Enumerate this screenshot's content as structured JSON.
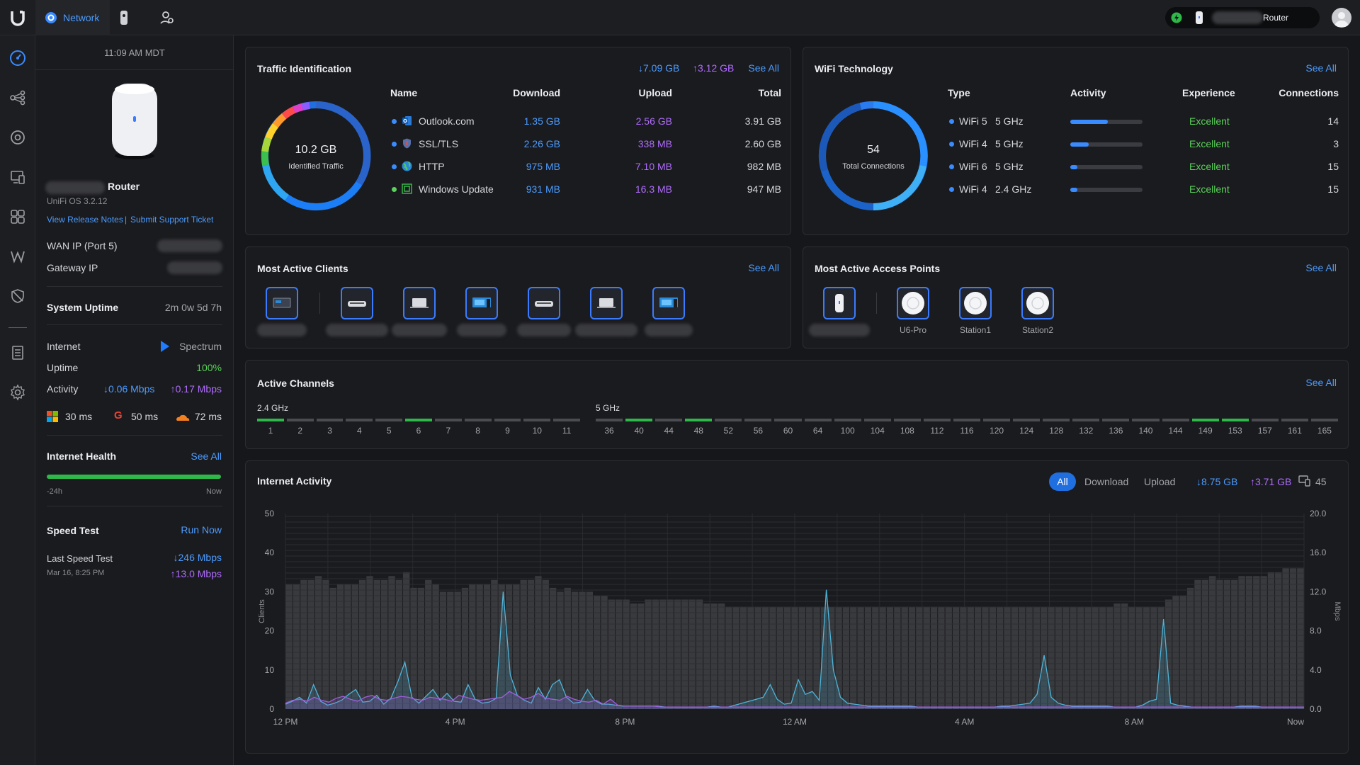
{
  "topbar": {
    "app_name": "Network",
    "device_name": "Router"
  },
  "side": {
    "time": "11:09 AM MDT",
    "device_name": "Router",
    "os_version": "UniFi OS 3.2.12",
    "release_notes": "View Release Notes",
    "separator": "|",
    "support_ticket": "Submit Support Ticket",
    "wan_ip_label": "WAN IP (Port 5)",
    "gateway_ip_label": "Gateway IP",
    "uptime_label": "System Uptime",
    "uptime_value": "2m 0w 5d 7h",
    "internet_label": "Internet",
    "isp": "Spectrum",
    "uptime2_label": "Uptime",
    "uptime2_value": "100%",
    "activity_label": "Activity",
    "activity_down": "↓0.06 Mbps",
    "activity_up": "↑0.17 Mbps",
    "latency_ms_windows": "30 ms",
    "latency_ms_google": "50 ms",
    "latency_ms_cloudflare": "72 ms",
    "health_label": "Internet Health",
    "health_seeall": "See All",
    "health_left": "-24h",
    "health_right": "Now",
    "speedtest_label": "Speed Test",
    "run_now": "Run Now",
    "last_speed_label": "Last Speed Test",
    "last_speed_date": "Mar 16, 8:25 PM",
    "last_speed_down": "↓246 Mbps",
    "last_speed_up": "↑13.0 Mbps"
  },
  "traffic": {
    "title": "Traffic Identification",
    "down_total": "↓7.09 GB",
    "up_total": "↑3.12 GB",
    "see_all": "See All",
    "center_value": "10.2 GB",
    "center_label": "Identified Traffic",
    "headers": [
      "Name",
      "Download",
      "Upload",
      "Total"
    ],
    "rows": [
      {
        "name": "Outlook.com",
        "download": "1.35 GB",
        "upload": "2.56 GB",
        "total": "3.91 GB",
        "dot": "#3a8bff",
        "icon": "outlook-icon"
      },
      {
        "name": "SSL/TLS",
        "download": "2.26 GB",
        "upload": "338 MB",
        "total": "2.60 GB",
        "dot": "#3a8bff",
        "icon": "shield-icon"
      },
      {
        "name": "HTTP",
        "download": "975 MB",
        "upload": "7.10 MB",
        "total": "982 MB",
        "dot": "#3a8bff",
        "icon": "globe-icon"
      },
      {
        "name": "Windows Update",
        "download": "931 MB",
        "upload": "16.3 MB",
        "total": "947 MB",
        "dot": "#5ad15a",
        "icon": "windows-update-icon"
      }
    ]
  },
  "wifi": {
    "title": "WiFi Technology",
    "see_all": "See All",
    "center_value": "54",
    "center_label": "Total Connections",
    "headers": [
      "Type",
      "Activity",
      "Experience",
      "Connections"
    ],
    "rows": [
      {
        "type": "WiFi 5",
        "band": "5 GHz",
        "activity": 0.52,
        "experience": "Excellent",
        "connections": "14"
      },
      {
        "type": "WiFi 4",
        "band": "5 GHz",
        "activity": 0.25,
        "experience": "Excellent",
        "connections": "3"
      },
      {
        "type": "WiFi 6",
        "band": "5 GHz",
        "activity": 0.1,
        "experience": "Excellent",
        "connections": "15"
      },
      {
        "type": "WiFi 4",
        "band": "2.4 GHz",
        "activity": 0.1,
        "experience": "Excellent",
        "connections": "15"
      }
    ]
  },
  "clients": {
    "title": "Most Active Clients",
    "see_all": "See All",
    "items": [
      {
        "icon": "desktop-icon"
      },
      {
        "icon": "console-icon"
      },
      {
        "icon": "laptop-icon"
      },
      {
        "icon": "tv-icon"
      },
      {
        "icon": "console-icon"
      },
      {
        "icon": "laptop-icon"
      },
      {
        "icon": "tv-icon"
      }
    ]
  },
  "aps": {
    "title": "Most Active Access Points",
    "see_all": "See All",
    "items": [
      {
        "label": "",
        "icon": "router-icon"
      },
      {
        "label": "U6-Pro",
        "icon": "access-point-icon"
      },
      {
        "label": "Station1",
        "icon": "access-point-icon"
      },
      {
        "label": "Station2",
        "icon": "access-point-icon"
      }
    ]
  },
  "channels": {
    "title": "Active Channels",
    "see_all": "See All",
    "band24_label": "2.4 GHz",
    "band5_label": "5 GHz",
    "band24": [
      "1",
      "2",
      "3",
      "4",
      "5",
      "6",
      "7",
      "8",
      "9",
      "10",
      "11"
    ],
    "band24_active": [
      "1",
      "6"
    ],
    "band5": [
      "36",
      "40",
      "44",
      "48",
      "52",
      "56",
      "60",
      "64",
      "100",
      "104",
      "108",
      "112",
      "116",
      "120",
      "124",
      "128",
      "132",
      "136",
      "140",
      "144",
      "149",
      "153",
      "157",
      "161",
      "165"
    ],
    "band5_active": [
      "40",
      "48",
      "149",
      "153"
    ]
  },
  "activity": {
    "title": "Internet Activity",
    "tab_all": "All",
    "tab_download": "Download",
    "tab_upload": "Upload",
    "down_total": "↓8.75 GB",
    "up_total": "↑3.71 GB",
    "client_count": "45"
  },
  "chart_data": {
    "type": "area",
    "title": "Internet Activity",
    "ylabel": "Clients",
    "y2label": "Mbps",
    "ylim": [
      0,
      50
    ],
    "y2lim": [
      0,
      20
    ],
    "yticks": [
      "50",
      "40",
      "30",
      "20",
      "10",
      "0"
    ],
    "y2ticks": [
      "20.0",
      "16.0",
      "12.0",
      "8.0",
      "4.0",
      "0.0"
    ],
    "xticks": [
      "12 PM",
      "4 PM",
      "8 PM",
      "12 AM",
      "4 AM",
      "8 AM",
      "Now"
    ],
    "clients": [
      32,
      32,
      33,
      33,
      34,
      33,
      31,
      32,
      32,
      32,
      33,
      34,
      33,
      33,
      34,
      33,
      35,
      31,
      31,
      33,
      32,
      30,
      30,
      30,
      31,
      32,
      32,
      32,
      33,
      32,
      32,
      32,
      33,
      33,
      34,
      33,
      31,
      30,
      31,
      30,
      30,
      30,
      29,
      29,
      28,
      28,
      28,
      27,
      27,
      28,
      28,
      28,
      28,
      28,
      28,
      28,
      28,
      27,
      27,
      27,
      26,
      26,
      26,
      26,
      26,
      26,
      26,
      26,
      26,
      26,
      26,
      26,
      26,
      26,
      26,
      26,
      26,
      26,
      26,
      26,
      26,
      26,
      26,
      26,
      26,
      26,
      26,
      26,
      26,
      26,
      26,
      26,
      26,
      26,
      26,
      26,
      26,
      26,
      26,
      26,
      26,
      26,
      26,
      26,
      26,
      26,
      26,
      26,
      26,
      26,
      26,
      26,
      26,
      27,
      27,
      26,
      26,
      26,
      26,
      26,
      28,
      29,
      29,
      31,
      33,
      33,
      34,
      33,
      33,
      33,
      34,
      34,
      34,
      34,
      35,
      35,
      36,
      36,
      36
    ],
    "series": [
      {
        "name": "Download",
        "color": "#4fb4d8",
        "values": [
          0.5,
          0.8,
          1.2,
          0.6,
          2.5,
          0.8,
          0.4,
          0.6,
          0.9,
          1.5,
          2.0,
          0.7,
          0.8,
          1.4,
          0.5,
          1.1,
          2.8,
          4.8,
          1.2,
          0.6,
          1.3,
          2.0,
          0.9,
          1.6,
          0.8,
          0.7,
          2.5,
          1.0,
          0.6,
          0.7,
          1.1,
          12.0,
          3.5,
          1.4,
          0.9,
          0.6,
          2.2,
          1.0,
          2.5,
          3.0,
          1.2,
          0.6,
          0.7,
          2.0,
          0.9,
          0.5,
          0.5,
          0.4,
          0.3,
          0.3,
          0.3,
          0.3,
          0.3,
          0.3,
          0.2,
          0.2,
          0.2,
          0.2,
          0.2,
          0.2,
          0.2,
          0.3,
          0.2,
          0.2,
          0.4,
          0.6,
          0.8,
          1.0,
          1.2,
          2.5,
          1.0,
          0.5,
          0.6,
          3.0,
          1.5,
          1.8,
          0.9,
          12.2,
          4.0,
          1.2,
          0.6,
          0.5,
          0.4,
          0.3,
          0.3,
          0.3,
          0.3,
          0.3,
          0.3,
          0.3,
          0.2,
          0.2,
          0.2,
          0.2,
          0.2,
          0.2,
          0.2,
          0.2,
          0.2,
          0.2,
          0.2,
          0.2,
          0.3,
          0.3,
          0.4,
          0.5,
          0.6,
          1.5,
          5.5,
          1.2,
          0.6,
          0.4,
          0.3,
          0.3,
          0.3,
          0.3,
          0.3,
          0.3,
          0.2,
          0.2,
          0.2,
          0.2,
          0.4,
          0.8,
          1.0,
          9.2,
          0.6,
          0.4,
          0.3,
          0.2,
          0.2,
          0.2,
          0.2,
          0.2,
          0.2,
          0.2,
          0.3,
          0.3,
          0.3,
          0.2,
          0.2,
          0.2,
          0.2,
          0.2,
          0.2,
          0.2
        ]
      },
      {
        "name": "Upload",
        "color": "#a05ee0",
        "values": [
          0.6,
          0.9,
          1.0,
          0.8,
          1.2,
          0.9,
          0.7,
          1.1,
          1.3,
          1.0,
          0.8,
          1.2,
          1.4,
          1.0,
          0.9,
          1.1,
          1.3,
          1.2,
          1.0,
          0.9,
          1.2,
          1.1,
          1.0,
          0.8,
          1.4,
          1.2,
          1.0,
          0.9,
          1.0,
          1.1,
          1.2,
          1.8,
          1.4,
          1.0,
          1.2,
          1.6,
          1.1,
          1.0,
          0.9,
          1.3,
          1.0,
          0.8,
          0.7,
          0.9,
          0.5,
          1.0,
          0.4,
          0.3,
          0.3,
          0.3,
          0.3,
          0.3,
          0.2,
          0.2,
          0.2,
          0.2,
          0.2,
          0.2,
          0.2,
          0.2,
          0.2,
          0.2,
          0.2,
          0.2,
          0.2,
          0.2,
          0.2,
          0.2,
          0.2,
          0.2,
          0.2,
          0.2,
          0.2,
          0.2,
          0.2,
          0.2,
          0.2,
          0.2,
          0.2,
          0.2,
          0.2,
          0.2,
          0.2,
          0.2,
          0.2,
          0.2,
          0.2,
          0.2,
          0.2,
          0.2,
          0.2,
          0.2,
          0.2,
          0.2,
          0.2,
          0.2,
          0.2,
          0.2,
          0.2,
          0.2,
          0.2,
          0.2,
          0.2,
          0.2,
          0.2,
          0.2,
          0.2,
          0.2,
          0.2,
          0.2,
          0.2,
          0.2,
          0.2,
          0.2,
          0.2,
          0.2,
          0.2,
          0.2,
          0.2,
          0.2,
          0.2,
          0.2,
          0.2,
          0.2,
          0.2,
          0.2,
          0.2,
          0.2,
          0.2,
          0.2,
          0.2,
          0.2,
          0.2,
          0.2,
          0.2,
          0.2,
          0.2,
          0.2,
          0.2,
          0.2,
          0.2,
          0.2
        ]
      }
    ]
  }
}
